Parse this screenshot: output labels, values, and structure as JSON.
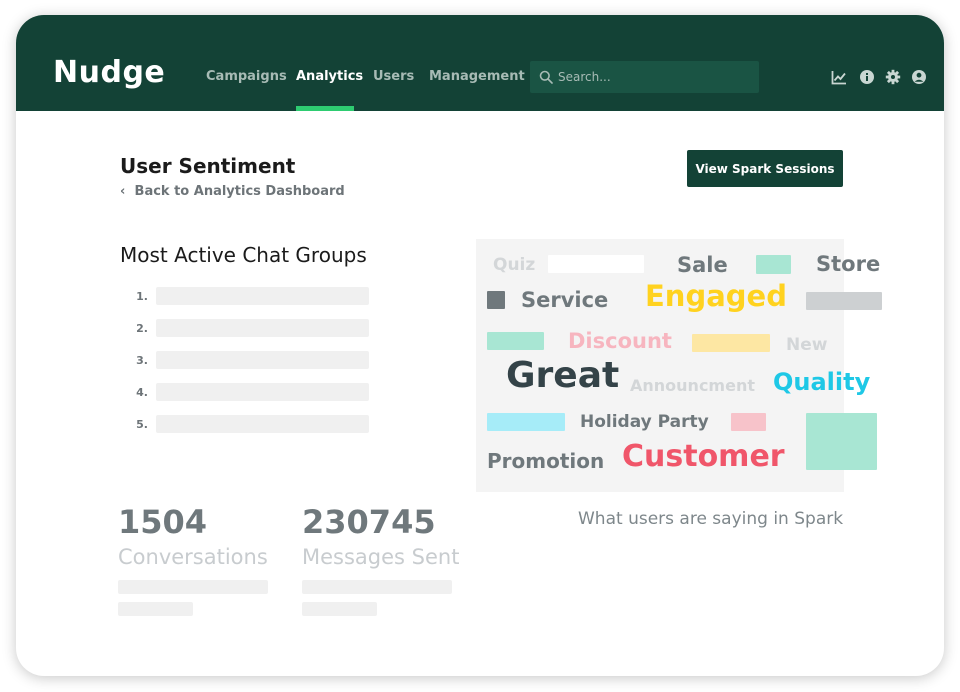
{
  "app": {
    "name": "Nudge"
  },
  "nav": {
    "items": [
      {
        "label": "Campaigns",
        "active": false
      },
      {
        "label": "Analytics",
        "active": true
      },
      {
        "label": "Users",
        "active": false
      },
      {
        "label": "Management",
        "active": false
      }
    ]
  },
  "search": {
    "placeholder": "Search..."
  },
  "header_icons": [
    "chart-icon",
    "info-icon",
    "gear-icon",
    "user-icon"
  ],
  "page": {
    "title": "User Sentiment",
    "back_link": "Back to Analytics Dashboard",
    "spark_button": "View Spark Sessions"
  },
  "chat_groups": {
    "title": "Most Active Chat Groups",
    "ranks": [
      "1.",
      "2.",
      "3.",
      "4.",
      "5."
    ]
  },
  "stats": [
    {
      "value": "1504",
      "label": "Conversations"
    },
    {
      "value": "230745",
      "label": "Messages Sent"
    }
  ],
  "word_cloud": {
    "words": [
      "Quiz",
      "Sale",
      "Store",
      "Service",
      "Engaged",
      "Discount",
      "New",
      "Great",
      "Announcment",
      "Quality",
      "Holiday Party",
      "Promotion",
      "Customer"
    ],
    "caption": "What users are saying in Spark"
  },
  "colors": {
    "header": "#134236",
    "accent": "#2ecc71",
    "engaged": "#ffd21f",
    "quality": "#1ec8e6",
    "customer": "#f0566a",
    "discount": "#f7b5bf"
  }
}
